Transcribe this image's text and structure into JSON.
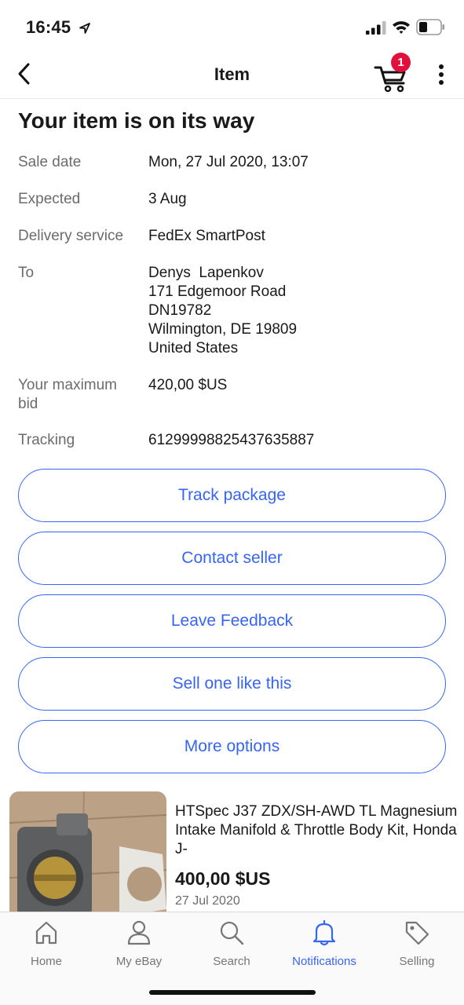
{
  "status_bar": {
    "time": "16:45"
  },
  "nav": {
    "title": "Item",
    "cart_count": "1"
  },
  "order": {
    "heading": "Your item is on its way",
    "sale_date_label": "Sale date",
    "sale_date": "Mon, 27 Jul 2020, 13:07",
    "expected_label": "Expected",
    "expected": "3 Aug",
    "delivery_label": "Delivery service",
    "delivery": "FedEx SmartPost",
    "to_label": "To",
    "address": [
      "Denys  Lapenkov",
      "171 Edgemoor Road",
      "DN19782",
      "Wilmington, DE 19809",
      "United States"
    ],
    "max_bid_label": "Your maximum bid",
    "max_bid": "420,00 $US",
    "tracking_label": "Tracking",
    "tracking": "61299998825437635887"
  },
  "actions": {
    "track": "Track package",
    "contact": "Contact seller",
    "feedback": "Leave Feedback",
    "sell": "Sell one like this",
    "more": "More options"
  },
  "item": {
    "title": "HTSpec J37 ZDX/SH-AWD TL Magnesium Intake Manifold & Throttle Body Kit, Honda J-",
    "price": "400,00 $US",
    "date": "27 Jul 2020"
  },
  "tabs": [
    {
      "label": "Home",
      "icon": "home-icon"
    },
    {
      "label": "My eBay",
      "icon": "person-icon"
    },
    {
      "label": "Search",
      "icon": "search-icon"
    },
    {
      "label": "Notifications",
      "icon": "bell-icon"
    },
    {
      "label": "Selling",
      "icon": "tag-icon"
    }
  ],
  "colors": {
    "accent": "#3665f3",
    "badge": "#e0103a",
    "text": "#191919",
    "muted": "#6b6b6b"
  }
}
